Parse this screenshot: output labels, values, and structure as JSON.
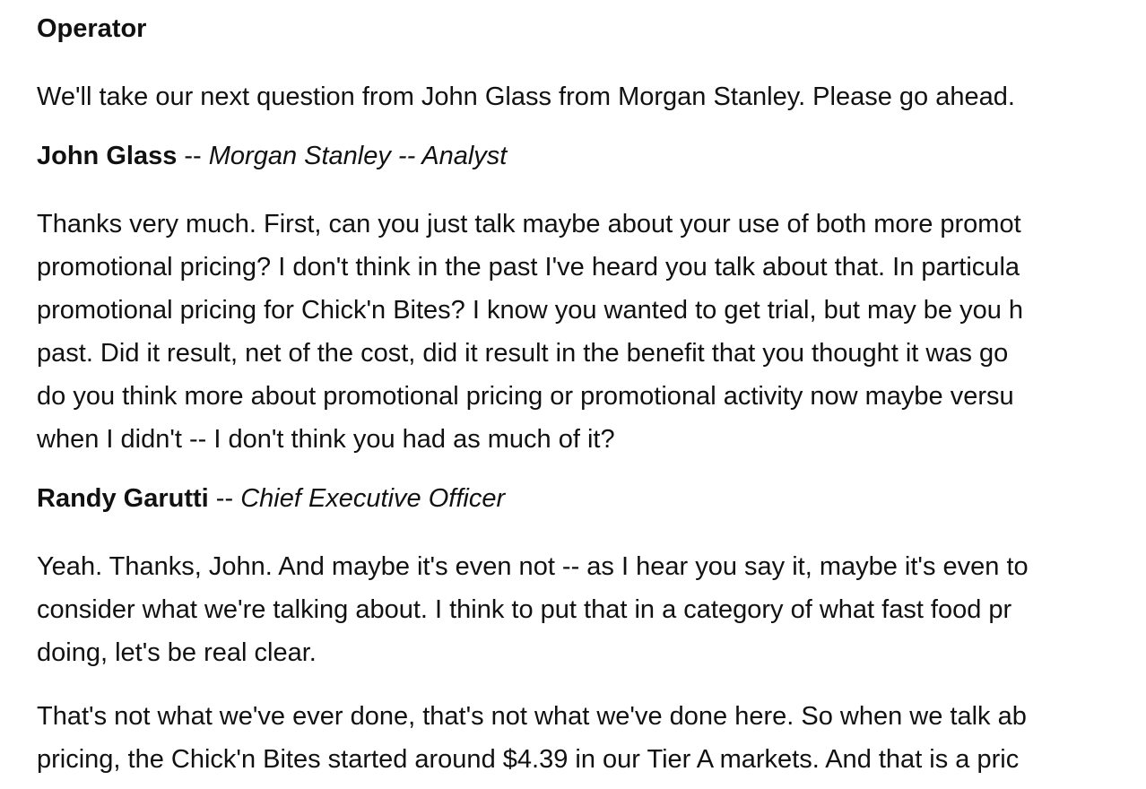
{
  "transcript": {
    "blocks": [
      {
        "speaker": {
          "name": "Operator",
          "sep": "",
          "role": ""
        },
        "lines": [
          "We'll take our next question from John Glass from Morgan Stanley. Please go ahead."
        ]
      },
      {
        "speaker": {
          "name": "John Glass",
          "sep": " -- ",
          "role": "Morgan Stanley -- Analyst"
        },
        "lines": [
          "Thanks very much. First, can you just talk maybe about your use of both more promot",
          "promotional pricing? I don't think in the past I've heard you talk about that. In particula",
          "promotional pricing for Chick'n Bites? I know you wanted to get trial, but may be you h",
          "past. Did it result, net of the cost, did it result in the benefit that you thought it was go",
          "do you think more about promotional pricing or promotional activity now maybe versu",
          "when I didn't -- I don't think you had as much of it?"
        ]
      },
      {
        "speaker": {
          "name": "Randy Garutti",
          "sep": " -- ",
          "role": "Chief Executive Officer"
        },
        "lines": [
          "Yeah. Thanks, John. And maybe it's even not -- as I hear you say it, maybe it's even to",
          "consider what we're talking about. I think to put that in a category of what fast food pr",
          "doing, let's be real clear."
        ]
      },
      {
        "speaker": null,
        "lines": [
          "That's not what we've ever done, that's not what we've done here. So when we talk ab",
          "pricing, the Chick'n Bites started around $4.39 in our Tier A markets. And that is a pric"
        ]
      }
    ]
  }
}
